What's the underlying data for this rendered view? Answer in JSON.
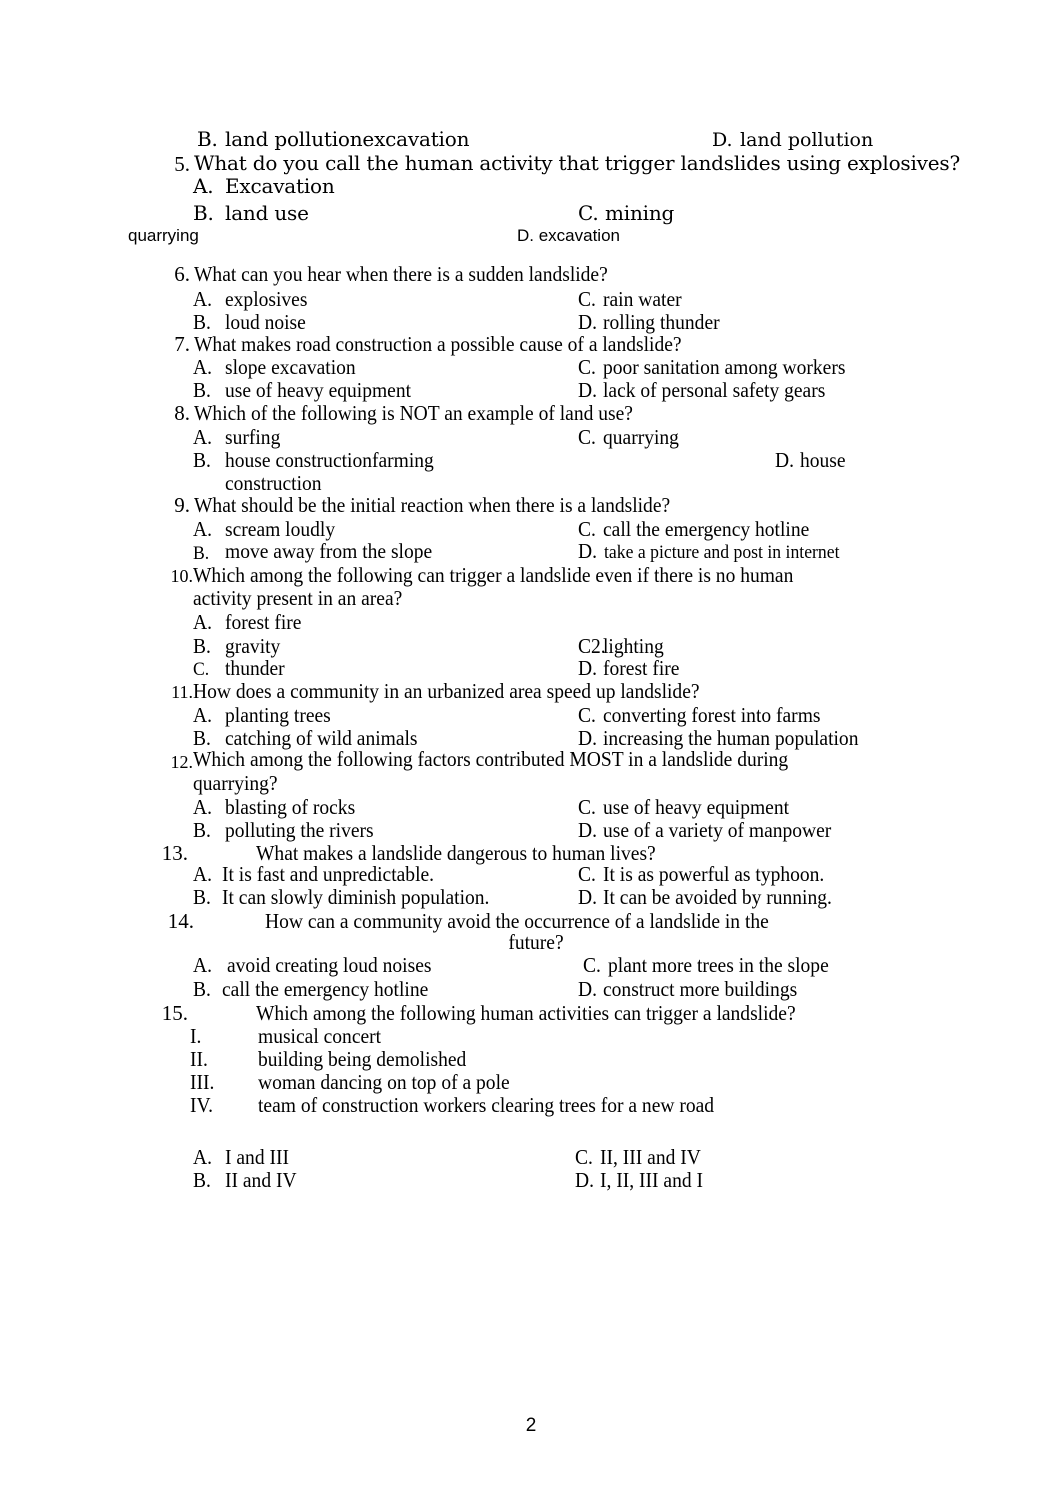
{
  "document": {
    "page_number": "2",
    "carryover_block": {
      "option_b": {
        "label": "B.",
        "text": "land pollutionexcavation"
      },
      "option_d": {
        "label": "D.",
        "text": "land pollution"
      }
    },
    "stray_lines": {
      "quarrying": "quarrying",
      "excavation": "D. excavation"
    },
    "questions": [
      {
        "number": "5.",
        "text": "What do you call the human activity that trigger landslides using explosives?",
        "options": [
          {
            "label": "A.",
            "text": "Excavation"
          },
          {
            "label": "B.",
            "text": "land use"
          },
          {
            "label": "C.",
            "text": "mining"
          }
        ]
      },
      {
        "number": "6.",
        "text": "What can you hear when there is a sudden landslide?",
        "options": [
          {
            "label": "A.",
            "text": "explosives"
          },
          {
            "label": "B.",
            "text": "loud noise"
          },
          {
            "label": "C.",
            "text": "rain water"
          },
          {
            "label": "D.",
            "text": "rolling thunder"
          }
        ]
      },
      {
        "number": "7.",
        "text": "What makes road construction a possible cause of a landslide?",
        "options": [
          {
            "label": "A.",
            "text": "slope excavation"
          },
          {
            "label": "B.",
            "text": "use of heavy equipment"
          },
          {
            "label": "C.",
            "text": "poor sanitation among workers"
          },
          {
            "label": "D.",
            "text": "lack of personal safety gears"
          }
        ]
      },
      {
        "number": "8.",
        "text": "Which of the following is NOT an example of land use?",
        "options": [
          {
            "label": "A.",
            "text": "surfing"
          },
          {
            "label": "B.",
            "text": "house constructionfarming"
          },
          {
            "label": "B_wrap",
            "text": "construction"
          },
          {
            "label": "C.",
            "text": "quarrying"
          },
          {
            "label": "D.",
            "text": "house"
          }
        ]
      },
      {
        "number": "9.",
        "text": "What should be the initial reaction when there is a landslide?",
        "options": [
          {
            "label": "A.",
            "text": "scream loudly"
          },
          {
            "label": "B.",
            "text": "move away from the slope"
          },
          {
            "label": "C.",
            "text": "call the emergency hotline"
          },
          {
            "label": "D.",
            "text": "take a picture and post in internet"
          }
        ]
      },
      {
        "number": "10.",
        "text": "Which among the following can trigger a landslide even if there is no human",
        "text_line2": "activity present in an area?",
        "options": [
          {
            "label": "A.",
            "text": "forest fire"
          },
          {
            "label": "B.",
            "text": "gravity"
          },
          {
            "label": "C.",
            "text": "thunder"
          },
          {
            "label": "C2.",
            "text": "lighting"
          },
          {
            "label": "D.",
            "text": "forest fire"
          }
        ]
      },
      {
        "number": "11.",
        "text": "How does a community in an urbanized area speed up landslide?",
        "options": [
          {
            "label": "A.",
            "text": "planting trees"
          },
          {
            "label": "B.",
            "text": "catching of wild animals"
          },
          {
            "label": "C.",
            "text": "converting forest into farms"
          },
          {
            "label": "D.",
            "text": "increasing the human population"
          }
        ]
      },
      {
        "number": "12.",
        "text": "Which among the following factors contributed MOST in a landslide during",
        "text_line2": "quarrying?",
        "options": [
          {
            "label": "A.",
            "text": "blasting of rocks"
          },
          {
            "label": "B.",
            "text": "polluting the rivers"
          },
          {
            "label": "C.",
            "text": "use of heavy equipment"
          },
          {
            "label": "D.",
            "text": "use of a variety of manpower"
          }
        ]
      },
      {
        "number": "13.",
        "text": "What makes a landslide dangerous to human lives?",
        "options": [
          {
            "label": "A.",
            "text": "It is fast and unpredictable."
          },
          {
            "label": "B.",
            "text": "It can slowly diminish population."
          },
          {
            "label": "C.",
            "text": "It is as powerful as typhoon."
          },
          {
            "label": "D.",
            "text": "It can be avoided by running."
          }
        ]
      },
      {
        "number": "14.",
        "text": "How can a community avoid the occurrence of a landslide in the",
        "text_line2": "future?",
        "options": [
          {
            "label": "A.",
            "text": "avoid creating loud noises"
          },
          {
            "label": "B.",
            "text": "call the emergency hotline"
          },
          {
            "label": "C.",
            "text": "plant more trees in the slope"
          },
          {
            "label": "D.",
            "text": "construct more buildings"
          }
        ]
      },
      {
        "number": "15.",
        "text": "Which among the following human activities can trigger a landslide?",
        "roman_items": [
          {
            "label": "I.",
            "text": "musical concert"
          },
          {
            "label": "II.",
            "text": "building being demolished"
          },
          {
            "label": "III.",
            "text": "woman dancing on top of a pole"
          },
          {
            "label": "IV.",
            "text": "team of construction workers clearing trees for a new road"
          }
        ],
        "options": [
          {
            "label": "A.",
            "text": "I and III"
          },
          {
            "label": "B.",
            "text": "II and IV"
          },
          {
            "label": "C.",
            "text": "II, III and IV"
          },
          {
            "label": "D.",
            "text": "I, II, III and I"
          }
        ]
      }
    ]
  }
}
